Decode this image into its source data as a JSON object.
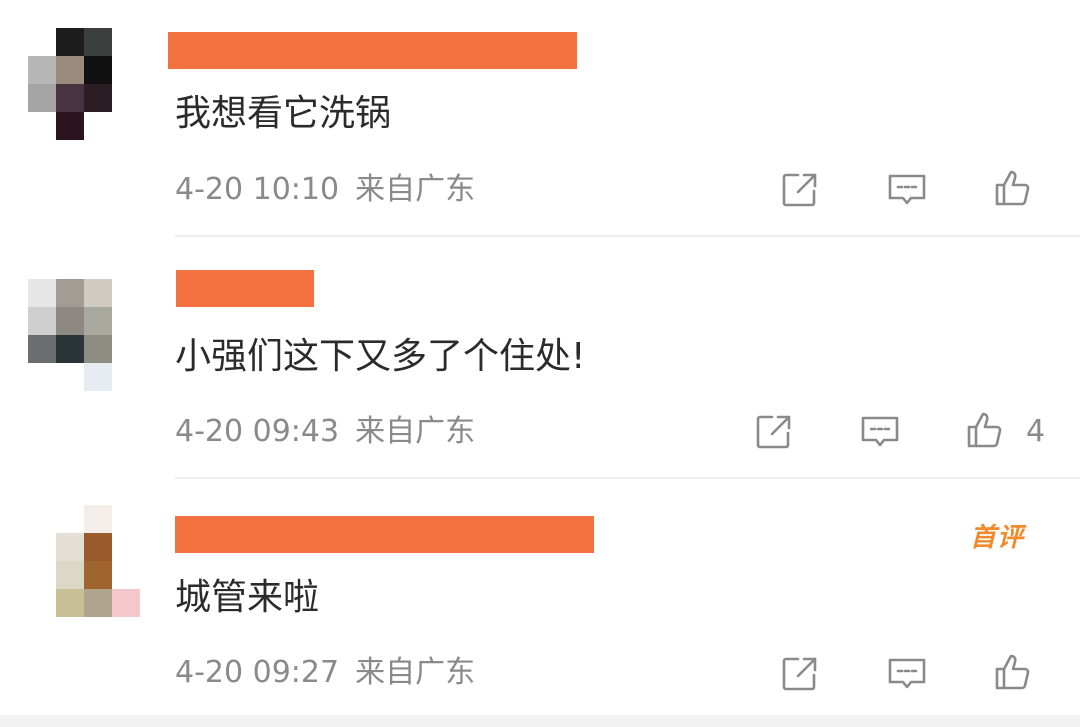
{
  "colors": {
    "name_redaction": "#f47140",
    "icon": "#8a8a8a",
    "badge": "#f08a2d"
  },
  "comments": [
    {
      "text": "我想看它洗锅",
      "time": "4-20 10:10",
      "location": "来自广东",
      "like_count": ""
    },
    {
      "text": "小强们这下又多了个住处!",
      "time": "4-20 09:43",
      "location": "来自广东",
      "like_count": "4"
    },
    {
      "text": "城管来啦",
      "time": "4-20 09:27",
      "location": "来自广东",
      "like_count": "",
      "badge": "首评"
    }
  ],
  "icons": {
    "share": "share-icon",
    "reply": "comment-icon",
    "like": "thumbs-up-icon"
  }
}
